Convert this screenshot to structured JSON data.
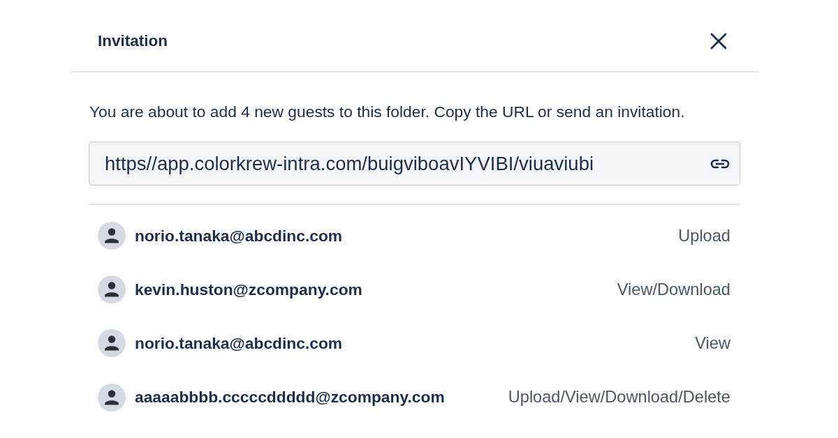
{
  "dialog": {
    "title": "Invitation",
    "message": "You are about to add 4 new guests to this folder. Copy the URL or send an invitation.",
    "url_field": {
      "value": "https//app.colorkrew-intra.com/buigviboavIYVIBI/viuaviubi"
    },
    "guests": [
      {
        "email": "norio.tanaka@abcdinc.com",
        "permission": "Upload"
      },
      {
        "email": "kevin.huston@zcompany.com",
        "permission": "View/Download"
      },
      {
        "email": "norio.tanaka@abcdinc.com",
        "permission": "View"
      },
      {
        "email": "aaaaabbbb.cccccddddd@zcompany.com",
        "permission": "Upload/View/Download/Delete"
      }
    ]
  }
}
